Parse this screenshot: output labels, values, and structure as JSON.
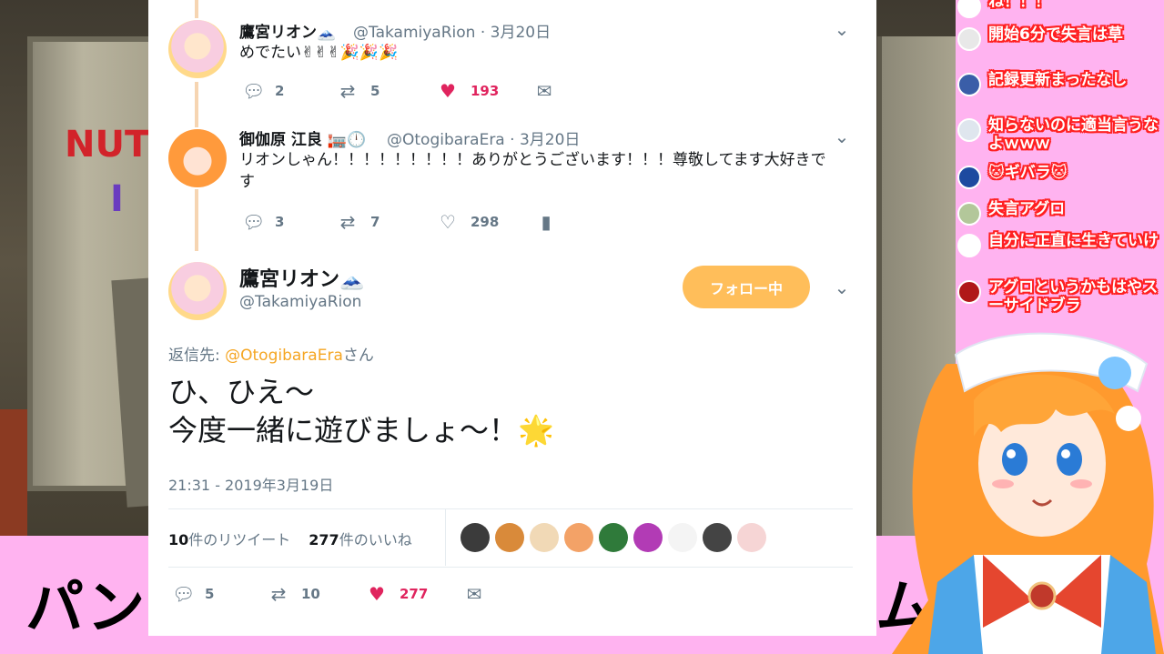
{
  "stream": {
    "banner_left": "パン",
    "banner_right": "ム"
  },
  "game": {
    "magnet_letters": "NUT",
    "magnet_letter2": "I"
  },
  "thread": [
    {
      "name": "鷹宮リオン🗻",
      "handle": "@TakamiyaRion",
      "date": "· 3月20日",
      "text": "めでたい✌✌✌🎉🎉🎉",
      "replies": "2",
      "retweets": "5",
      "likes": "193",
      "liked": true
    },
    {
      "name": "御伽原 江良 🏣🕛",
      "handle": "@OtogibaraEra",
      "date": "· 3月20日",
      "text": "リオンしゃん！！！！！！！！！ありがとうございます！！！尊敬してます大好きです",
      "replies": "3",
      "retweets": "7",
      "likes": "298",
      "liked": false
    }
  ],
  "main_tweet": {
    "name": "鷹宮リオン🗻",
    "handle": "@TakamiyaRion",
    "follow_label": "フォロー中",
    "reply_prefix": "返信先: ",
    "reply_mention": "@OtogibaraEra",
    "reply_suffix": "さん",
    "text_line1": "ひ、ひえ～",
    "text_line2": "今度一緒に遊びましょ～！🌟",
    "timestamp": "21:31 - 2019年3月19日",
    "retweet_count": "10",
    "retweet_label": "件のリツイート",
    "like_count": "277",
    "like_label": "件のいいね",
    "replies": "5",
    "retweets": "10",
    "likes": "277"
  },
  "likers": [
    {
      "color": "#3b3b3b"
    },
    {
      "color": "#d98a3a"
    },
    {
      "color": "#f1d9b6"
    },
    {
      "color": "#f3a267"
    },
    {
      "color": "#2f7a3a"
    },
    {
      "color": "#b23bb5"
    },
    {
      "color": "#f4f4f4"
    },
    {
      "color": "#444444"
    },
    {
      "color": "#f6d5d5"
    }
  ],
  "chat": [
    {
      "text": "ね！！！",
      "avatar": "#ffffff"
    },
    {
      "text": "開始6分で失言は草",
      "avatar": "#e8e8e8"
    },
    {
      "text": "記録更新まったなし",
      "avatar": "#3a5ea8"
    },
    {
      "text": "知らないのに適当言うなよｗｗｗ",
      "avatar": "#dfe6ee"
    },
    {
      "text": "🐱ギバラ🐱",
      "avatar": "#1d4aa0"
    },
    {
      "text": "失言アグロ",
      "avatar": "#b3c79a"
    },
    {
      "text": "自分に正直に生きていけ",
      "avatar": "#ffffff"
    },
    {
      "text": "アグロというかもはやスーサイドブラ",
      "avatar": "#b01818"
    }
  ]
}
